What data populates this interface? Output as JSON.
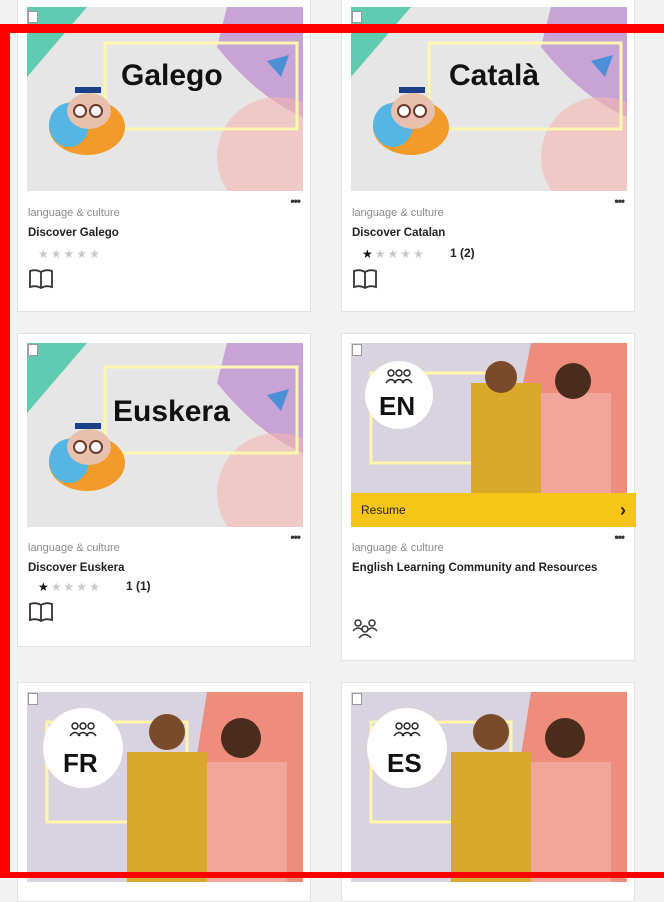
{
  "cards": [
    {
      "thumb_word": "Galego",
      "category": "language & culture",
      "title": "Discover Galego",
      "rating_text": ""
    },
    {
      "thumb_word": "Català",
      "category": "language & culture",
      "title": "Discover Catalan",
      "rating_text": "1 (2)"
    },
    {
      "thumb_word": "Euskera",
      "category": "language & culture",
      "title": "Discover Euskera",
      "rating_text": "1 (1)"
    },
    {
      "badge": "EN",
      "resume_label": "Resume",
      "resume_arrow": "›",
      "category": "language & culture",
      "title": "English Learning Community and Resources"
    },
    {
      "badge": "FR"
    },
    {
      "badge": "ES"
    }
  ],
  "ratings": [
    0,
    1,
    1
  ],
  "stars": {
    "filled": "★",
    "empty": "★"
  },
  "more_label": "•••",
  "icons": {
    "course": "book-icon",
    "community": "community-icon",
    "bookmark": "bookmark-icon",
    "more": "more-options-icon"
  },
  "colors": {
    "accent_yellow": "#f5c518",
    "annotation_red": "#ff0000",
    "card_bg": "#ffffff",
    "page_bg": "#f2f2f2"
  }
}
